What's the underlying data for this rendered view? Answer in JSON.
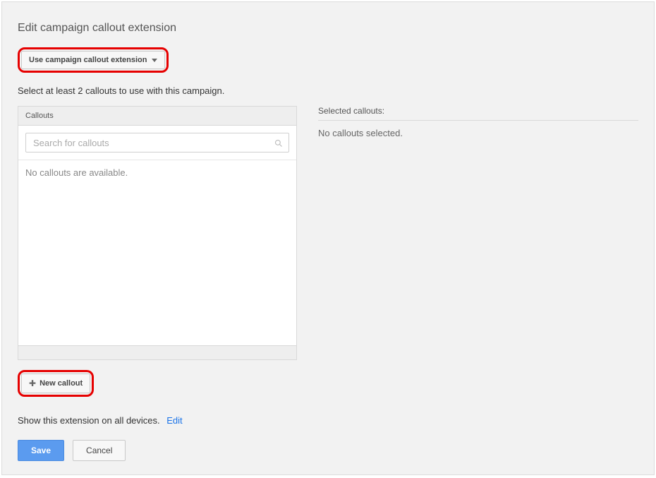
{
  "header": {
    "title": "Edit campaign callout extension"
  },
  "dropdown": {
    "label": "Use campaign callout extension"
  },
  "instruction": "Select at least 2 callouts to use with this campaign.",
  "callouts_panel": {
    "header": "Callouts",
    "search_placeholder": "Search for callouts",
    "empty": "No callouts are available."
  },
  "selected": {
    "header": "Selected callouts:",
    "empty": "No callouts selected."
  },
  "new_callout": {
    "label": "New callout"
  },
  "device": {
    "prefix": "Show this extension on",
    "value": "all devices.",
    "edit": "Edit"
  },
  "actions": {
    "save": "Save",
    "cancel": "Cancel"
  }
}
